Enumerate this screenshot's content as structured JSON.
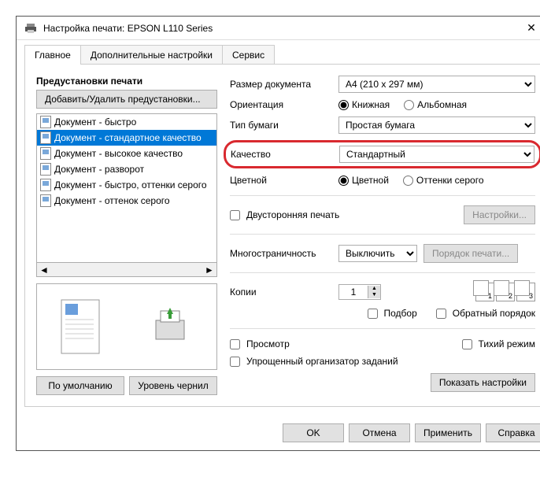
{
  "window": {
    "title": "Настройка печати: EPSON L110 Series"
  },
  "tabs": {
    "main": "Главное",
    "advanced": "Дополнительные настройки",
    "service": "Сервис"
  },
  "presets": {
    "heading": "Предустановки печати",
    "addRemove": "Добавить/Удалить предустановки...",
    "items": [
      "Документ - быстро",
      "Документ - стандартное качество",
      "Документ - высокое качество",
      "Документ - разворот",
      "Документ - быстро, оттенки серого",
      "Документ - оттенок серого"
    ],
    "defaultBtn": "По умолчанию",
    "inkBtn": "Уровень чернил"
  },
  "labels": {
    "docSize": "Размер документа",
    "orientation": "Ориентация",
    "paperType": "Тип бумаги",
    "quality": "Качество",
    "color": "Цветной",
    "duplex": "Двусторонняя печать",
    "settings": "Настройки...",
    "multipage": "Многостраничность",
    "printOrder": "Порядок печати...",
    "copies": "Копии",
    "collate": "Подбор",
    "reverse": "Обратный порядок",
    "preview": "Просмотр",
    "quiet": "Тихий режим",
    "simplified": "Упрощенный организатор заданий",
    "showSettings": "Показать настройки"
  },
  "values": {
    "docSize": "A4 (210 x 297 мм)",
    "portrait": "Книжная",
    "landscape": "Альбомная",
    "paperType": "Простая бумага",
    "quality": "Стандартный",
    "colorYes": "Цветной",
    "colorGray": "Оттенки серого",
    "multipage": "Выключить",
    "copies": "1"
  },
  "footer": {
    "ok": "OK",
    "cancel": "Отмена",
    "apply": "Применить",
    "help": "Справка"
  }
}
